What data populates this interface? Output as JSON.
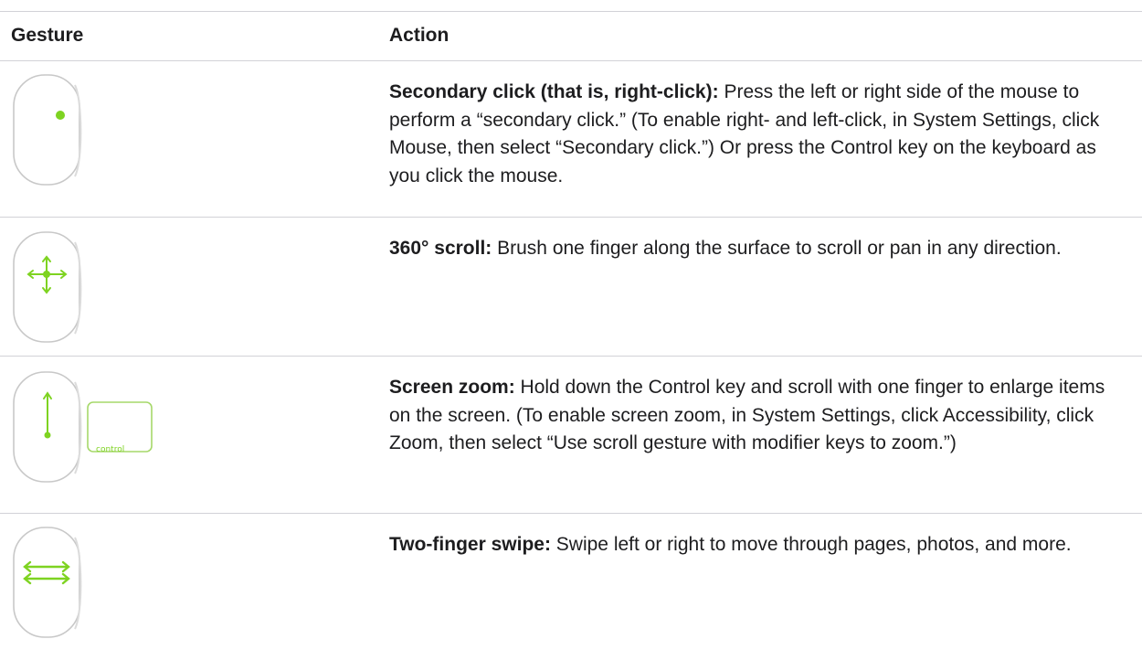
{
  "header": {
    "gesture_label": "Gesture",
    "action_label": "Action"
  },
  "rows": [
    {
      "icon": "mouse-secondary-click-icon",
      "term": "Secondary click (that is, right-click):",
      "description": " Press the left or right side of the mouse to perform a “secondary click.” (To enable right- and left-click, in System Settings, click Mouse, then select “Secondary click.”) Or press the Control key on the keyboard as you click the mouse."
    },
    {
      "icon": "mouse-360-scroll-icon",
      "term": "360° scroll:",
      "description": " Brush one finger along the surface to scroll or pan in any direction."
    },
    {
      "icon": "mouse-screen-zoom-icon",
      "key_label": "control",
      "term": "Screen zoom:",
      "description": " Hold down the Control key and scroll with one finger to enlarge items on the screen. (To enable screen zoom, in System Settings, click Accessibility, click Zoom, then select “Use scroll gesture with modifier keys to zoom.”)"
    },
    {
      "icon": "mouse-two-finger-swipe-icon",
      "term": "Two-finger swipe:",
      "description": " Swipe left or right to move through pages, photos, and more."
    }
  ],
  "colors": {
    "accent_green": "#7ed321",
    "rule": "#d2d2d7",
    "text": "#1d1d1f",
    "mouse_outline": "#c8c8c8"
  }
}
